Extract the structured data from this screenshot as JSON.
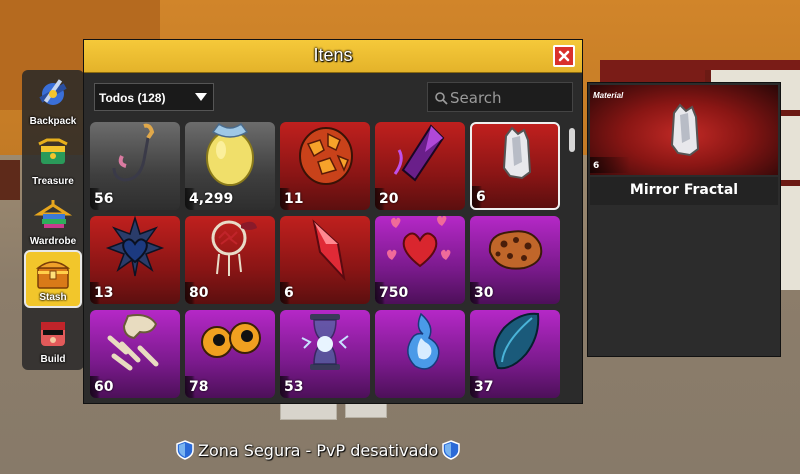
{
  "window": {
    "title": "Itens"
  },
  "side_nav": {
    "items": [
      {
        "label": "Backpack",
        "icon": "backpack-icon",
        "active": false
      },
      {
        "label": "Treasure",
        "icon": "treasure-icon",
        "active": false
      },
      {
        "label": "Wardrobe",
        "icon": "wardrobe-icon",
        "active": false
      },
      {
        "label": "Stash",
        "icon": "chest-icon",
        "active": true
      },
      {
        "label": "Build",
        "icon": "build-icon",
        "active": false
      }
    ]
  },
  "filter": {
    "selected": "Todos (128)"
  },
  "search": {
    "placeholder": "Search",
    "value": ""
  },
  "items": [
    {
      "count": "56",
      "rarity": "gray",
      "icon": "fishing-hook-icon"
    },
    {
      "count": "4,299",
      "rarity": "gray",
      "icon": "golden-egg-icon"
    },
    {
      "count": "11",
      "rarity": "red",
      "icon": "magma-ore-icon"
    },
    {
      "count": "20",
      "rarity": "red",
      "icon": "dark-crystal-icon"
    },
    {
      "count": "6",
      "rarity": "red",
      "icon": "mirror-fractal-icon",
      "selected": true
    },
    {
      "count": "13",
      "rarity": "red",
      "icon": "dark-heart-icon"
    },
    {
      "count": "80",
      "rarity": "red",
      "icon": "dreamcatcher-icon"
    },
    {
      "count": "6",
      "rarity": "red",
      "icon": "red-crystal-icon"
    },
    {
      "count": "750",
      "rarity": "purple",
      "icon": "hearts-icon"
    },
    {
      "count": "30",
      "rarity": "purple",
      "icon": "meteorite-icon"
    },
    {
      "count": "60",
      "rarity": "purple",
      "icon": "bones-icon"
    },
    {
      "count": "78",
      "rarity": "purple",
      "icon": "eyeballs-icon"
    },
    {
      "count": "53",
      "rarity": "purple",
      "icon": "hourglass-icon"
    },
    {
      "count": "",
      "rarity": "purple",
      "icon": "blue-flame-icon"
    },
    {
      "count": "37",
      "rarity": "purple",
      "icon": "leviathan-scale-icon"
    }
  ],
  "detail": {
    "category": "Material",
    "count": "6",
    "name": "Mirror Fractal"
  },
  "status": {
    "text": "Zona Segura - PvP desativado"
  }
}
